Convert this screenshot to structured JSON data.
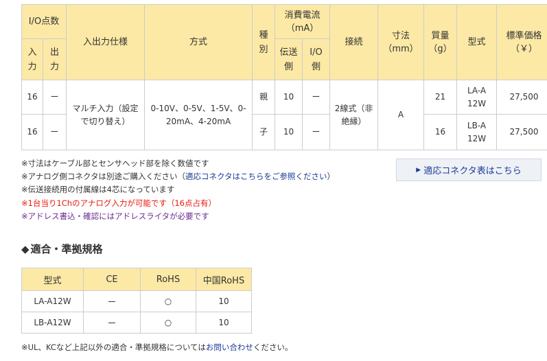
{
  "spec_table": {
    "headers": {
      "io_points": "I/O点数",
      "input": "入力",
      "output": "出力",
      "io_spec": "入出力仕様",
      "method": "方式",
      "type_class": "種別",
      "current": "消費電流",
      "current_unit": "（mA）",
      "transmit_side": "伝送側",
      "io_side": "I/O側",
      "connection": "接続",
      "dimensions": "寸法",
      "dimensions_unit": "（mm）",
      "weight": "質量",
      "weight_unit": "（g）",
      "model": "型式",
      "price": "標準価格",
      "price_unit": "（￥）"
    },
    "io_spec_value": "マルチ入力（設定で切り替え）",
    "method_value": "0-10V、0-5V、1-5V、0-20mA、4-20mA",
    "connection_value": "2線式（非絶縁）",
    "dimensions_value": "A",
    "rows": [
      {
        "input": "16",
        "output": "ー",
        "type": "親",
        "transmit": "10",
        "io": "ー",
        "weight": "21",
        "model": "LA-A12W",
        "price": "27,500"
      },
      {
        "input": "16",
        "output": "ー",
        "type": "子",
        "transmit": "10",
        "io": "ー",
        "weight": "16",
        "model": "LB-A12W",
        "price": "27,500"
      }
    ]
  },
  "notes": {
    "n1": "※寸法はケーブル部とセンサヘッド部を除く数値です",
    "n2_prefix": "※アナログ側コネクタは別途ご購入ください（",
    "n2_link": "適応コネクタはこちらをご参照ください",
    "n2_suffix": "）",
    "n3": "※伝送接続用の付属線は4芯になっています",
    "n4": "※1台当り1Chのアナログ入力が可能です（16点占有）",
    "n5": "※アドレス書込・確認にはアドレスライタが必要です"
  },
  "connector_button": {
    "icon": "▶",
    "label": "適応コネクタ表はこちら"
  },
  "standards": {
    "title_marker": "◆",
    "title": "適合・準拠規格",
    "headers": [
      "型式",
      "CE",
      "RoHS",
      "中国RoHS"
    ],
    "rows": [
      [
        "LA-A12W",
        "ー",
        "○",
        "10"
      ],
      [
        "LB-A12W",
        "ー",
        "○",
        "10"
      ]
    ]
  },
  "footer_note": {
    "prefix": "※UL、KCなど上記以外の適合・準拠規格については",
    "link": "お問い合わせ",
    "suffix": "ください。"
  }
}
